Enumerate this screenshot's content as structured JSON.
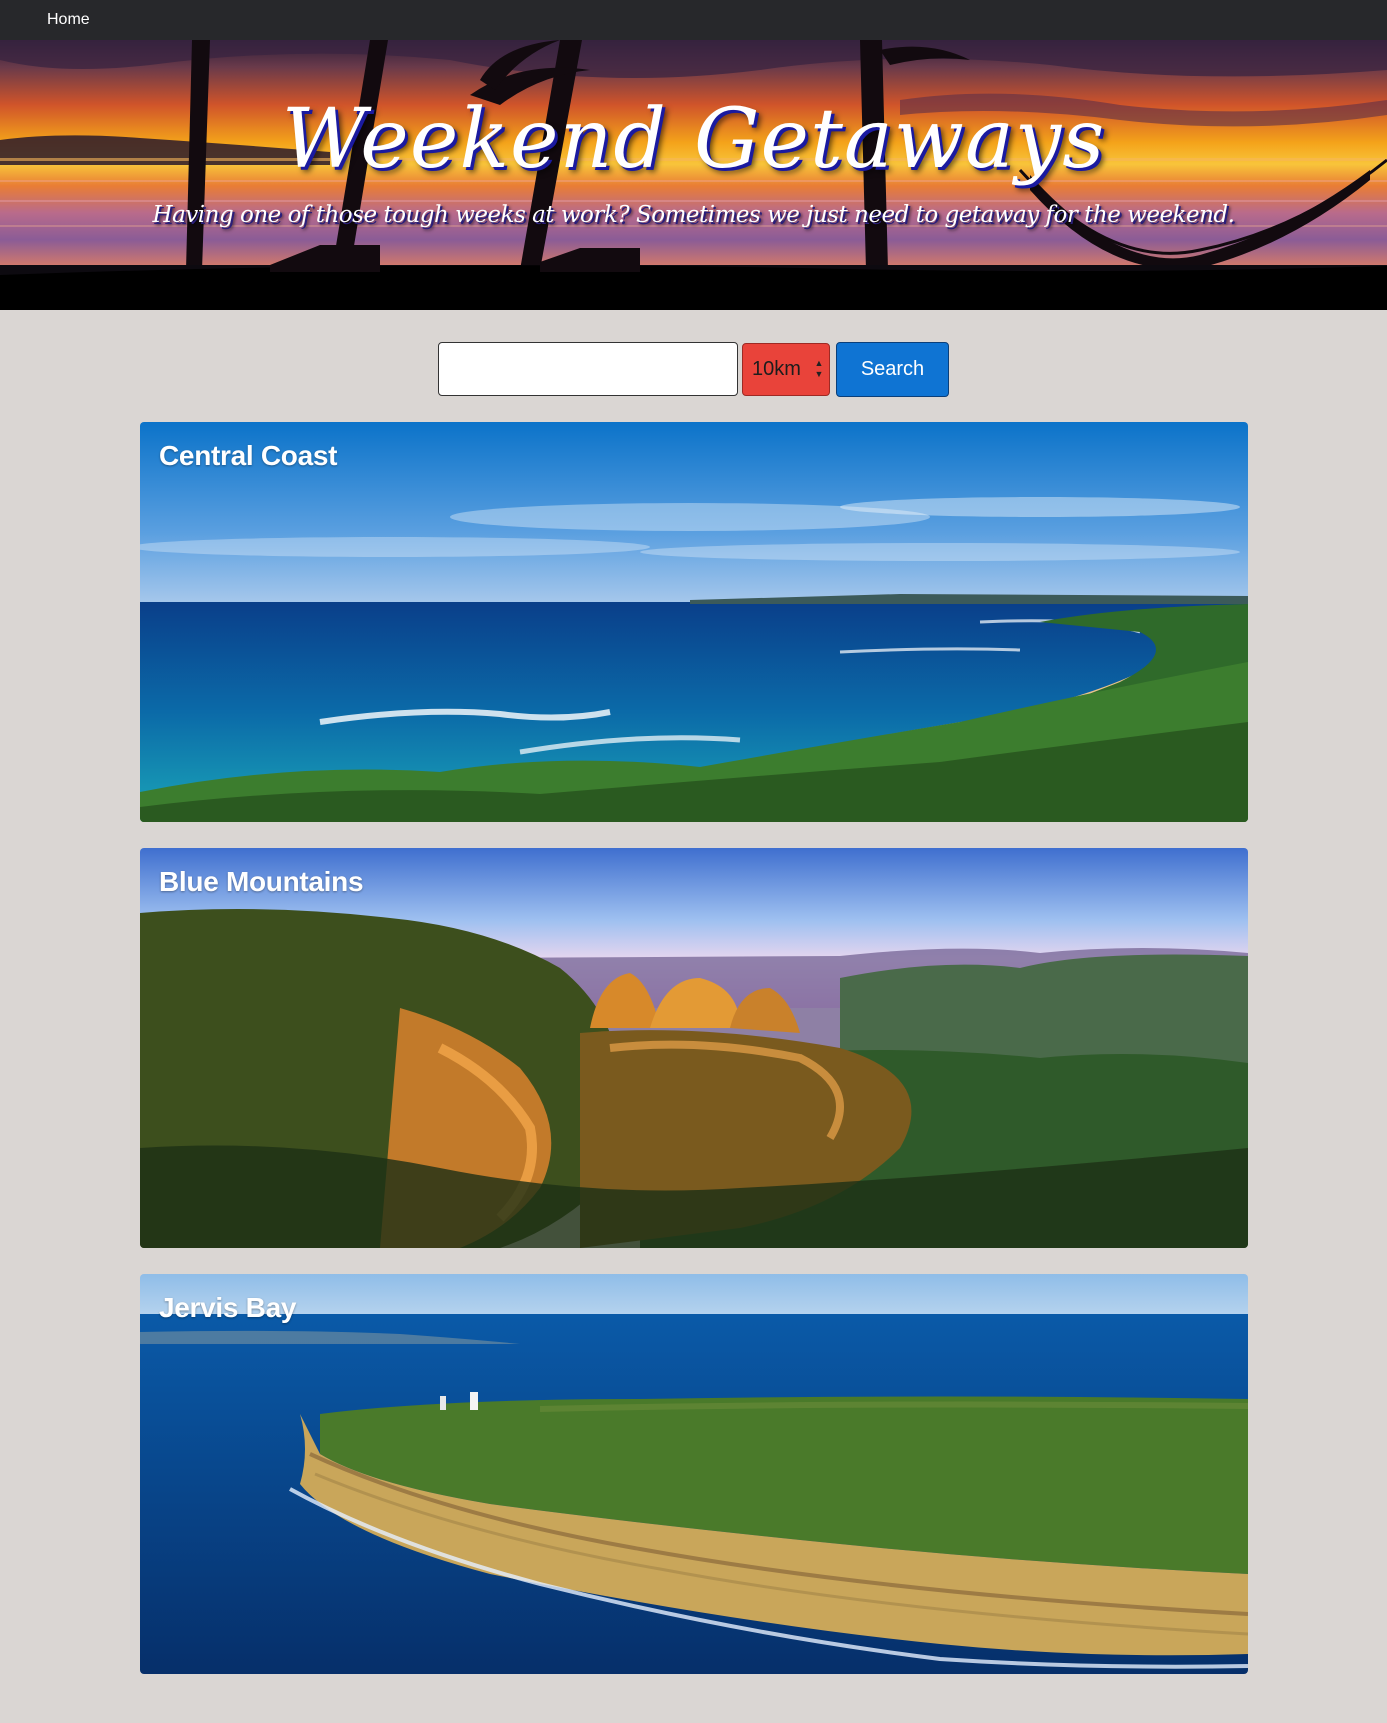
{
  "nav": {
    "home_label": "Home"
  },
  "hero": {
    "title": "Weekend Getaways",
    "subtitle": "Having one of those tough weeks at work? Sometimes we just need to getaway for the weekend."
  },
  "search": {
    "query_value": "",
    "distance_selected": "10km",
    "button_label": "Search"
  },
  "destinations": [
    {
      "name": "Central Coast"
    },
    {
      "name": "Blue Mountains"
    },
    {
      "name": "Jervis Bay"
    }
  ],
  "colors": {
    "nav_background": "#27282b",
    "page_background": "#dad6d3",
    "select_background": "#e9433a",
    "button_background": "#0f74d3"
  }
}
